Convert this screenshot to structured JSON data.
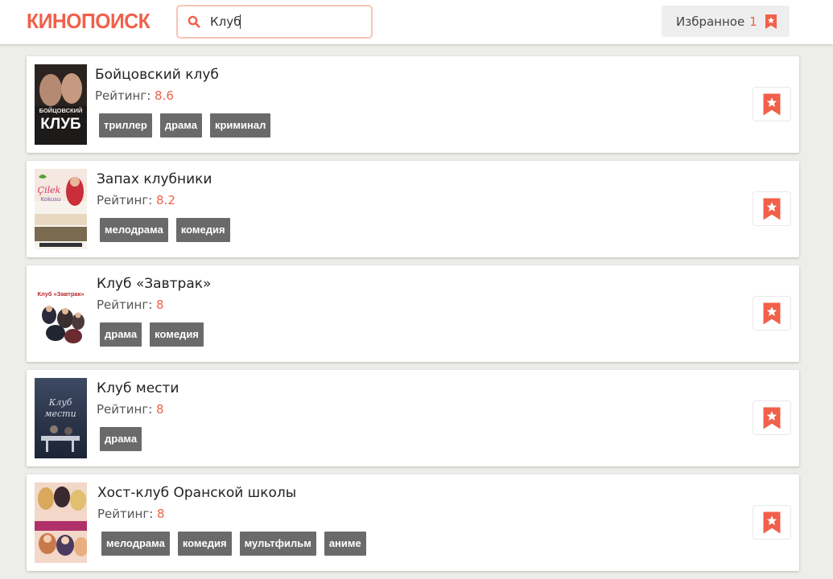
{
  "header": {
    "logo": "КИНОПОИСК",
    "search": {
      "value": "Клуб",
      "placeholder": ""
    },
    "favorites": {
      "label": "Избранное",
      "count": "1"
    }
  },
  "colors": {
    "accent": "#f1604a",
    "genre_bg": "#6a6a6a",
    "page_bg": "#ededea"
  },
  "rating_label": "Рейтинг:",
  "movies": [
    {
      "title": "Бойцовский клуб",
      "rating": "8.6",
      "genres": [
        "триллер",
        "драма",
        "криминал"
      ],
      "poster_text": [
        "БОЙЦОВСКИЙ",
        "КЛУБ"
      ],
      "bookmarked": true
    },
    {
      "title": "Запах клубники",
      "rating": "8.2",
      "genres": [
        "мелодрама",
        "комедия"
      ],
      "poster_text": [
        "Çilek",
        "Kokusu"
      ],
      "bookmarked": true
    },
    {
      "title": "Клуб «Завтрак»",
      "rating": "8",
      "genres": [
        "драма",
        "комедия"
      ],
      "poster_text": [
        "Клуб «Завтрак»"
      ],
      "bookmarked": true
    },
    {
      "title": "Клуб мести",
      "rating": "8",
      "genres": [
        "драма"
      ],
      "poster_text": [
        "Клуб",
        "мести"
      ],
      "bookmarked": true
    },
    {
      "title": "Хост-клуб Оранской школы",
      "rating": "8",
      "genres": [
        "мелодрама",
        "комедия",
        "мультфильм",
        "аниме"
      ],
      "poster_text": [],
      "bookmarked": true
    }
  ]
}
